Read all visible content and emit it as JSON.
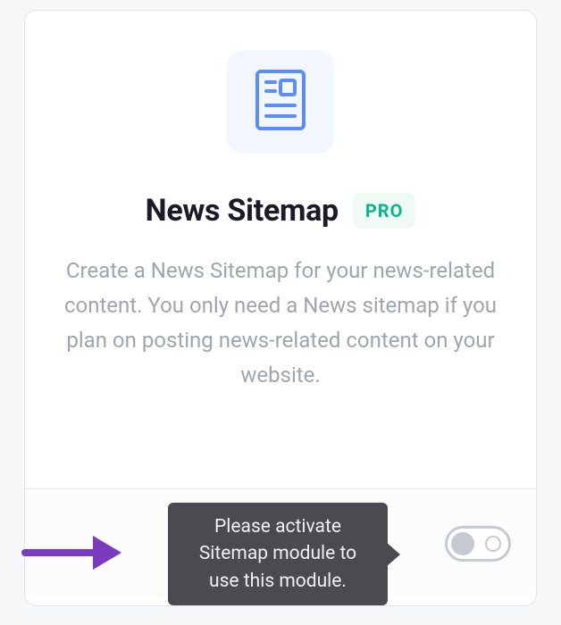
{
  "module": {
    "title": "News Sitemap",
    "badge": "PRO",
    "description": "Create a News Sitemap for your news-related content. You only need a News sitemap if you plan on posting news-related content on your website.",
    "icon": "newspaper-icon",
    "toggle_state": "off"
  },
  "tooltip": {
    "message": "Please activate Sitemap module to use this module."
  },
  "colors": {
    "brand_green": "#06b888",
    "purple_arrow": "#7b3bbf",
    "icon_blue": "#5c8df6",
    "text": "#1b1b27",
    "muted": "#a0a4ad",
    "tooltip_bg": "#4a4b50"
  }
}
